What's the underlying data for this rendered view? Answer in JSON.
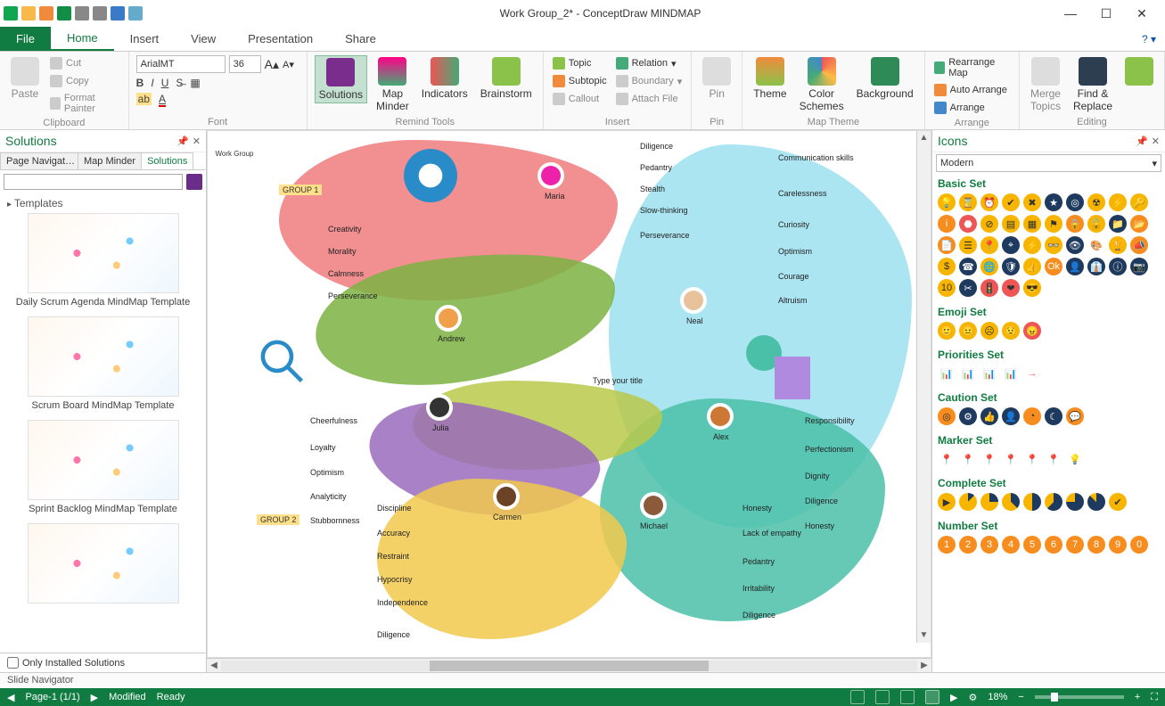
{
  "window": {
    "title": "Work Group_2* - ConceptDraw MINDMAP"
  },
  "menu": {
    "file": "File",
    "tabs": [
      "Home",
      "Insert",
      "View",
      "Presentation",
      "Share"
    ],
    "active": "Home"
  },
  "ribbon": {
    "clipboard": {
      "label": "Clipboard",
      "paste": "Paste",
      "cut": "Cut",
      "copy": "Copy",
      "format_painter": "Format Painter"
    },
    "font": {
      "label": "Font",
      "family": "ArialMT",
      "size": "36"
    },
    "remind": {
      "label": "Remind Tools",
      "solutions": "Solutions",
      "map_minder": "Map\nMinder",
      "indicators": "Indicators",
      "brainstorm": "Brainstorm"
    },
    "insert": {
      "label": "Insert",
      "topic": "Topic",
      "subtopic": "Subtopic",
      "callout": "Callout",
      "relation": "Relation",
      "boundary": "Boundary",
      "attach_file": "Attach  File"
    },
    "pin": {
      "label": "Pin",
      "pin": "Pin"
    },
    "map_theme": {
      "label": "Map Theme",
      "theme": "Theme",
      "color_schemes": "Color\nSchemes",
      "background": "Background"
    },
    "arrange": {
      "label": "Arrange",
      "rearrange": "Rearrange Map",
      "auto": "Auto Arrange",
      "arrange": "Arrange"
    },
    "editing": {
      "label": "Editing",
      "merge": "Merge\nTopics",
      "find_replace": "Find &\nReplace"
    }
  },
  "left_panel": {
    "title": "Solutions",
    "tabs": [
      "Page Navigat…",
      "Map Minder",
      "Solutions"
    ],
    "active_tab": "Solutions",
    "templates_header": "Templates",
    "templates": [
      "Daily Scrum Agenda MindMap Template",
      "Scrum Board MindMap Template",
      "Sprint Backlog MindMap Template"
    ],
    "only_installed": "Only Installed Solutions"
  },
  "mindmap": {
    "center": "Work Group",
    "center_hint": "Type your title",
    "group1": "GROUP 1",
    "group2": "GROUP 2",
    "people": {
      "maria": "Maria",
      "andrew": "Andrew",
      "neal": "Neal",
      "julia": "Julia",
      "carmen": "Carmen",
      "michael": "Michael",
      "alex": "Alex"
    },
    "maria_traits": [
      "Diligence",
      "Pedantry",
      "Stealth",
      "Slow-thinking",
      "Perseverance"
    ],
    "andrew_traits": [
      "Creativity",
      "Morality",
      "Calmness",
      "Perseverance"
    ],
    "neal_traits": [
      "Communication skills",
      "Carelessness",
      "Curiosity",
      "Optimism",
      "Courage",
      "Altruism"
    ],
    "julia_traits": [
      "Cheerfulness",
      "Loyalty",
      "Optimism",
      "Analyticity",
      "Stubbornness"
    ],
    "carmen_traits": [
      "Discipline",
      "Accuracy",
      "Restraint",
      "Hypocrisy",
      "Independence",
      "Diligence"
    ],
    "michael_traits": [
      "Honesty",
      "Lack of empathy",
      "Pedantry",
      "Irritability",
      "Diligence"
    ],
    "alex_traits": [
      "Responsibility",
      "Perfectionism",
      "Dignity",
      "Diligence",
      "Honesty"
    ]
  },
  "right_panel": {
    "title": "Icons",
    "style": "Modern",
    "sections": [
      "Basic Set",
      "Emoji Set",
      "Priorities Set",
      "Caution Set",
      "Marker Set",
      "Complete Set",
      "Number Set"
    ]
  },
  "slide_navigator": "Slide Navigator",
  "status": {
    "page": "Page-1 (1/1)",
    "modified": "Modified",
    "ready": "Ready",
    "zoom": "18%"
  }
}
